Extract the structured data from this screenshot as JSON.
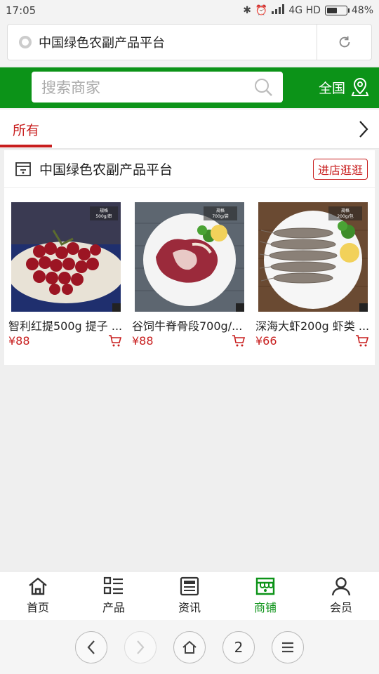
{
  "status_bar": {
    "time": "17:05",
    "network": "4G HD",
    "battery": "48%",
    "battery_level": 0.48
  },
  "browser": {
    "page_title": "中国绿色农副产品平台",
    "tab_count": "2"
  },
  "search": {
    "placeholder": "搜索商家",
    "region_label": "全国"
  },
  "tabs": {
    "active_label": "所有"
  },
  "store": {
    "name": "中国绿色农副产品平台",
    "visit_label": "进店逛逛",
    "products": [
      {
        "name": "智利红提500g 提子 ...",
        "price": "¥88",
        "spec_badge": "规格 500g/串"
      },
      {
        "name": "谷饲牛脊骨段700g/...",
        "price": "¥88",
        "spec_badge": "规格 700g/袋"
      },
      {
        "name": "深海大虾200g 虾类 ...",
        "price": "¥66",
        "spec_badge": "规格 200g/包"
      }
    ]
  },
  "bottom_nav": [
    {
      "label": "首页",
      "icon": "home-icon"
    },
    {
      "label": "产品",
      "icon": "list-icon"
    },
    {
      "label": "资讯",
      "icon": "news-icon"
    },
    {
      "label": "商铺",
      "icon": "store-icon",
      "active": true
    },
    {
      "label": "会员",
      "icon": "user-icon"
    }
  ],
  "colors": {
    "brand_green": "#0c9318",
    "accent_red": "#c81e1e"
  }
}
